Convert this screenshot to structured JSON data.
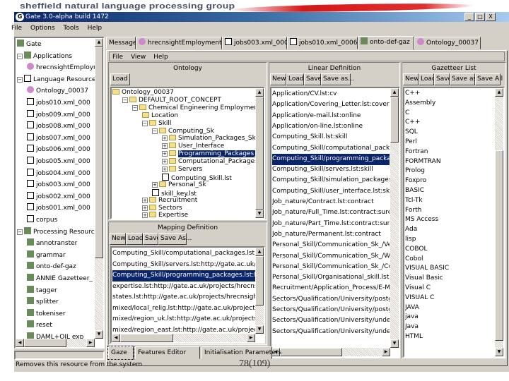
{
  "banner": {
    "text": "sheffield natural language processing group"
  },
  "window": {
    "title": "Gate 3.0-alpha build 1472",
    "controls": [
      "_",
      "□",
      "X"
    ]
  },
  "menu": [
    "File",
    "Options",
    "Tools",
    "Help"
  ],
  "resource_tree": [
    {
      "label": "Gate",
      "level": 0,
      "icon": "gate-icon"
    },
    {
      "label": "Applications",
      "level": 0,
      "icon": "applications-icon",
      "expander": "−"
    },
    {
      "label": "hrecnsightEmploym",
      "level": 1,
      "icon": "application-icon"
    },
    {
      "label": "Language Resources",
      "level": 0,
      "icon": "language-resources-icon",
      "expander": "−"
    },
    {
      "label": "Ontology_00037",
      "level": 1,
      "icon": "ontology-icon"
    },
    {
      "label": "jobs010.xml_000",
      "level": 1,
      "icon": "document-icon"
    },
    {
      "label": "jobs009.xml_000",
      "level": 1,
      "icon": "document-icon"
    },
    {
      "label": "jobs008.xml_000",
      "level": 1,
      "icon": "document-icon"
    },
    {
      "label": "jobs007.xml_000",
      "level": 1,
      "icon": "document-icon"
    },
    {
      "label": "jobs006.xml_000",
      "level": 1,
      "icon": "document-icon"
    },
    {
      "label": "jobs005.xml_000",
      "level": 1,
      "icon": "document-icon"
    },
    {
      "label": "jobs004.xml_000",
      "level": 1,
      "icon": "document-icon"
    },
    {
      "label": "jobs003.xml_000",
      "level": 1,
      "icon": "document-icon"
    },
    {
      "label": "jobs002.xml_000",
      "level": 1,
      "icon": "document-icon"
    },
    {
      "label": "jobs001.xml_000",
      "level": 1,
      "icon": "document-icon"
    },
    {
      "label": "corpus",
      "level": 1,
      "icon": "corpus-icon"
    },
    {
      "label": "Processing Resources",
      "level": 0,
      "icon": "processing-resources-icon",
      "expander": "−"
    },
    {
      "label": "annotranster",
      "level": 1,
      "icon": "processing-resource-icon"
    },
    {
      "label": "grammar",
      "level": 1,
      "icon": "processing-resource-icon"
    },
    {
      "label": "onto-def-gaz",
      "level": 1,
      "icon": "gazetteer-icon"
    },
    {
      "label": "ANNIE Gazetteer_",
      "level": 1,
      "icon": "gazetteer-icon"
    },
    {
      "label": "tagger",
      "level": 1,
      "icon": "processing-resource-icon"
    },
    {
      "label": "splitter",
      "level": 1,
      "icon": "processing-resource-icon"
    },
    {
      "label": "tokeniser",
      "level": 1,
      "icon": "tokeniser-icon"
    },
    {
      "label": "reset",
      "level": 1,
      "icon": "processing-resource-icon"
    },
    {
      "label": "DAML+OIL exp",
      "level": 1,
      "icon": "daml-icon"
    }
  ],
  "tabs": [
    "Messages",
    "hrecnsightEmployment",
    "jobs003.xml_0005F",
    "jobs010.xml_00063",
    "onto-def-gaz",
    "Ontology_00037"
  ],
  "active_tab": 4,
  "inner_menu": [
    "File",
    "View",
    "Help"
  ],
  "ontology": {
    "title": "Ontology",
    "load": "Load",
    "tree": [
      {
        "label": "Ontology_00037",
        "level": 0,
        "type": "folder"
      },
      {
        "label": "DEFAULT_ROOT_CONCEPT",
        "level": 1,
        "type": "folder",
        "expander": "−"
      },
      {
        "label": "Chemical Engineering Employment",
        "level": 2,
        "type": "folder",
        "expander": "−"
      },
      {
        "label": "Location",
        "level": 3,
        "type": "folder"
      },
      {
        "label": "Skill",
        "level": 3,
        "type": "folder",
        "expander": "−"
      },
      {
        "label": "Computing_Sk",
        "level": 4,
        "type": "folder",
        "expander": "−"
      },
      {
        "label": "Simulation_Packages_Sk",
        "level": 5,
        "type": "folder",
        "expander": "+"
      },
      {
        "label": "User_Interface",
        "level": 5,
        "type": "folder",
        "expander": "+"
      },
      {
        "label": "Programming_Packages_Sk",
        "level": 5,
        "type": "folder",
        "expander": "+",
        "selected": true
      },
      {
        "label": "Computational_Packages_Sk",
        "level": 5,
        "type": "folder",
        "expander": "+"
      },
      {
        "label": "Servers",
        "level": 5,
        "type": "folder",
        "expander": "+"
      },
      {
        "label": "Computing_Skill.lst",
        "level": 5,
        "type": "doc"
      },
      {
        "label": "Personal_Sk",
        "level": 4,
        "type": "folder",
        "expander": "+"
      },
      {
        "label": "skill_key.lst",
        "level": 4,
        "type": "doc"
      },
      {
        "label": "Recruitment",
        "level": 3,
        "type": "folder",
        "expander": "+"
      },
      {
        "label": "Sectors",
        "level": 3,
        "type": "folder",
        "expander": "+"
      },
      {
        "label": "Expertise",
        "level": 3,
        "type": "folder",
        "expander": "+"
      }
    ]
  },
  "mapping": {
    "title": "Mapping Definition",
    "buttons": [
      "New",
      "Load",
      "Save",
      "Save As..."
    ],
    "items": [
      "Computing_Skill/computational_packages.lst:http://g",
      "Computing_Skill/servers.lst:http://gate.ac.uk/projec",
      "Computing_Skill/programming_packages.lst:http://g",
      "expertise.lst:http://gate.ac.uk/projects/hrecnsight/E",
      "states.lst:http://gate.ac.uk/projects/hrecnsight/Emp",
      "mixed/local_relig.lst:http://gate.ac.uk/projects/hrech",
      "mixed/region_uk.lst:http://gate.ac.uk/projects/hrecns",
      "mixed/region_east.lst:http://gate.ac.uk/projects/hrec"
    ],
    "selected": 2
  },
  "linear": {
    "title": "Linear Definition",
    "buttons": [
      "New",
      "Load",
      "Save",
      "Save as..."
    ],
    "items": [
      "Application/CV.lst:cv",
      "Application/Covering_Letter.lst:covering",
      "Application/e-mail.lst:online",
      "Application/on-line.lst:online",
      "Computing_Skill.lst:skill",
      "Computing_Skill/computational_packages.lst",
      "Computing_Skill/programming_packages.lst",
      "Computing_Skill/servers.lst:skill",
      "Computing_Skill/simulation_packages.lst:skill",
      "Computing_Skill/user_interface.lst:skill",
      "Job_nature/Contract.lst:contract",
      "Job_nature/Full_Time.lst:contract:sure",
      "Job_nature/Part_Time.lst:contract:sure",
      "Job_nature/Permanent.lst:contract",
      "Personal_Skill/Communication_Sk_/Verbal.",
      "Personal_Skill/Communication_Sk_/Written.l",
      "Personal_Skill/Communication_Sk_/Commun",
      "Personal_Skill/Organisational_skill.lst:sk",
      "Recruitment/Application_Process/E-Mail.lst:",
      "Sectors/Qualification/University/postgradua",
      "Sectors/Qualification/University/postgradua",
      "Sectors/Qualification/University/undergradu",
      "Sectors/Qualification/University/undergradu"
    ],
    "selected": 6
  },
  "gazetteer": {
    "title": "Gazetteer List",
    "buttons": [
      "New",
      "Load",
      "Save",
      "Save as...",
      "Save All"
    ],
    "items": [
      "C++",
      "Assembly",
      "C",
      "C++",
      "SQL",
      "Perl",
      "Fortran",
      "FORMTRAN",
      "Prolog",
      "Foxpro",
      "BASIC",
      "Tcl-Tk",
      "Forth",
      "MS Access",
      "Ada",
      "lisp",
      "COBOL",
      "Cobol",
      "VISUAL BASIC",
      "Visual Basic",
      "Visual C",
      "VISUAL C",
      "JAVA",
      "java",
      "Java",
      "HTML"
    ]
  },
  "bottom_tabs": [
    "Gaze",
    "Features Editor",
    "Initialisation Parameters"
  ],
  "status": "Removes this resource from the system",
  "page_number": "78(109)"
}
